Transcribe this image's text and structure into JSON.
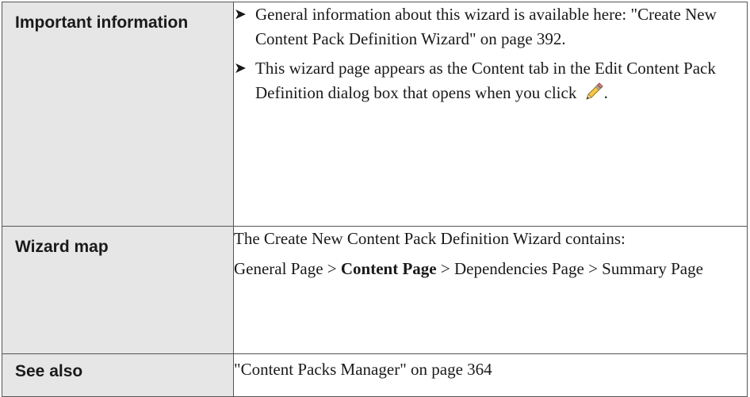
{
  "rows": [
    {
      "label": "Important information",
      "bullets": [
        "General information about this wizard is available here: \"Create New Content Pack Definition Wizard\" on page 392.",
        "This wizard page appears as the Content tab in the Edit Content Pack Definition dialog box that opens when you click"
      ],
      "bullet_after_icon": ".",
      "icon": "pencil-icon"
    },
    {
      "label": "Wizard map",
      "paragraph1": "The Create New Content Pack Definition Wizard contains:",
      "map": {
        "general": "General Page",
        "separator": " > ",
        "content": "Content Page",
        "dependencies": "Dependencies Page",
        "summary": "Summary Page"
      }
    },
    {
      "label": "See also",
      "text": "\"Content Packs Manager\" on page 364"
    }
  ],
  "bullet_glyph": "➤"
}
